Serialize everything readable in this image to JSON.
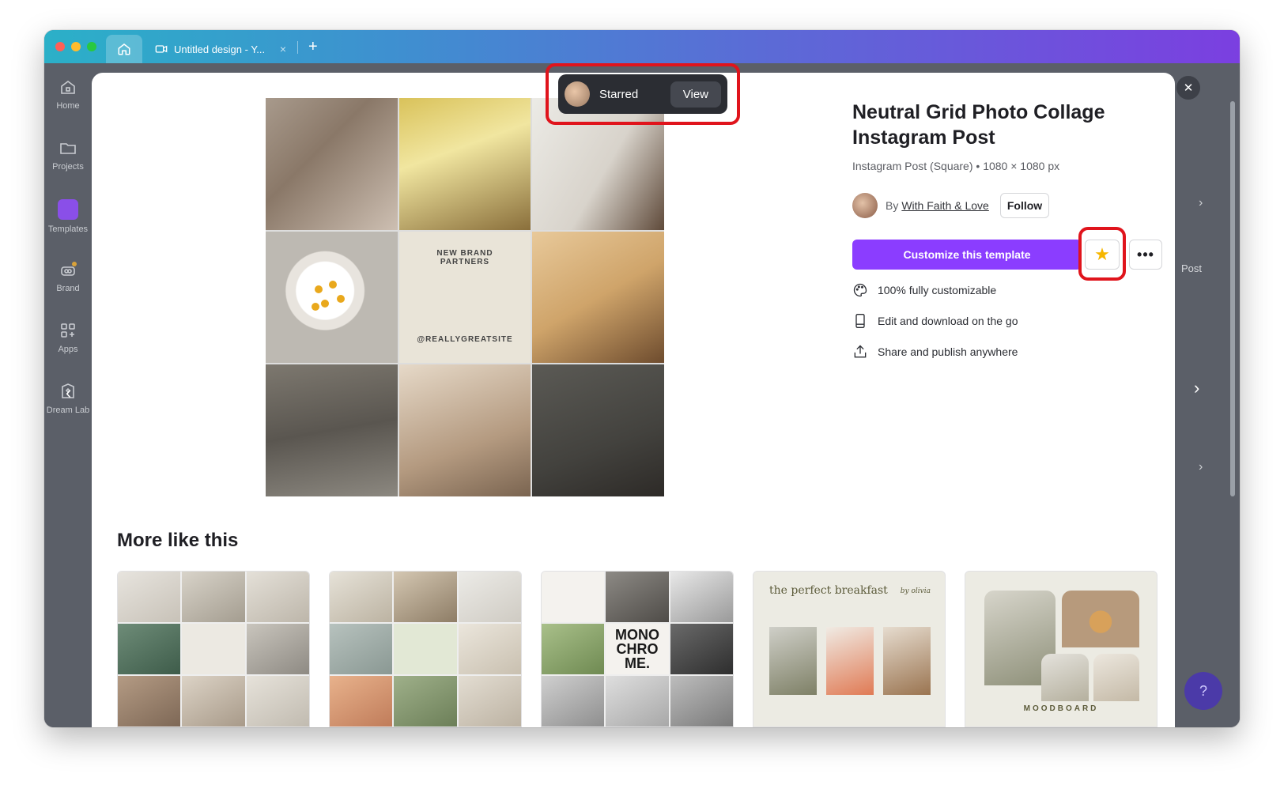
{
  "browser": {
    "tab_title": "Untitled design - Y...",
    "tab_close": "×",
    "new_tab": "+"
  },
  "sidebar": {
    "items": [
      {
        "label": "Home",
        "icon": "home-icon"
      },
      {
        "label": "Projects",
        "icon": "folder-icon"
      },
      {
        "label": "Templates",
        "icon": "templates-icon"
      },
      {
        "label": "Brand",
        "icon": "brand-icon"
      },
      {
        "label": "Apps",
        "icon": "apps-icon"
      },
      {
        "label": "Dream Lab",
        "icon": "dream-lab-icon"
      }
    ]
  },
  "toast": {
    "label": "Starred",
    "action": "View"
  },
  "template": {
    "title": "Neutral Grid Photo Collage Instagram Post",
    "subtitle": "Instagram Post (Square) • 1080 × 1080 px",
    "author_prefix": "By",
    "author_name": "With Faith & Love",
    "follow_label": "Follow",
    "customize_label": "Customize this template",
    "more_label": "•••",
    "features": [
      {
        "label": "100% fully customizable",
        "icon": "palette-icon"
      },
      {
        "label": "Edit and download on the go",
        "icon": "mobile-icon"
      },
      {
        "label": "Share and publish anywhere",
        "icon": "share-icon"
      }
    ],
    "hero_text_line1": "NEW BRAND",
    "hero_text_line2": "PARTNERS",
    "hero_handle": "@REALLYGREATSITE"
  },
  "more_like_this": {
    "title": "More like this",
    "breakfast_title": "the perfect breakfast",
    "breakfast_by": "by olivia",
    "moodboard": "MOODBOARD",
    "mono_text": "MONO CHRO ME."
  },
  "right_strip": {
    "peek_label": "Post"
  },
  "colors": {
    "accent": "#8b3dff",
    "highlight": "#e0141c",
    "star": "#f6b600"
  },
  "help": {
    "label": "?"
  }
}
